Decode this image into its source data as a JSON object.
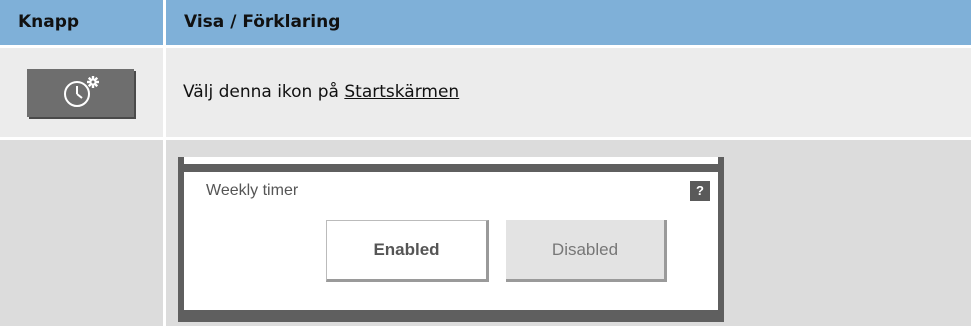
{
  "table": {
    "headers": [
      "Knapp",
      "Visa / Förklaring"
    ],
    "row1": {
      "button_icon": "clock-settings-icon",
      "text_prefix": "Välj denna ikon på ",
      "link_text": "Startskärmen"
    },
    "row2": {
      "screenshot": {
        "title": "Weekly timer",
        "help_label": "?",
        "enabled_label": "Enabled",
        "disabled_label": "Disabled"
      }
    }
  },
  "colors": {
    "header_bg": "#7fb0d8",
    "row1_bg": "#ececec",
    "row2_bg": "#dcdcdc",
    "icon_button_bg": "#6e6e6e",
    "screen_frame": "#5f5f5f"
  }
}
